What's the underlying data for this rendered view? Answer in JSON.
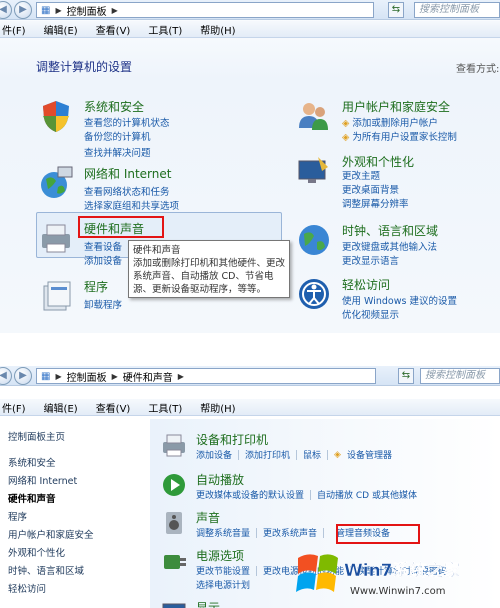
{
  "window1": {
    "breadcrumb": [
      "控制面板"
    ],
    "search_placeholder": "搜索控制面板",
    "menu": [
      "件(F)",
      "编辑(E)",
      "查看(V)",
      "工具(T)",
      "帮助(H)"
    ],
    "heading": "调整计算机的设置",
    "view_by": "查看方式:",
    "categories_left": [
      {
        "title": "系统和安全",
        "links": [
          "查看您的计算机状态",
          "备份您的计算机",
          "查找并解决问题"
        ]
      },
      {
        "title": "网络和 Internet",
        "links": [
          "查看网络状态和任务",
          "选择家庭组和共享选项"
        ]
      },
      {
        "title": "硬件和声音",
        "links": [
          "查看设备",
          "添加设备"
        ]
      },
      {
        "title": "程序",
        "links": [
          "卸载程序"
        ]
      }
    ],
    "categories_right": [
      {
        "title": "用户帐户和家庭安全",
        "links": [
          "添加或删除用户帐户",
          "为所有用户设置家长控制"
        ]
      },
      {
        "title": "外观和个性化",
        "links": [
          "更改主题",
          "更改桌面背景",
          "调整屏幕分辨率"
        ]
      },
      {
        "title": "时钟、语言和区域",
        "links": [
          "更改键盘或其他输入法",
          "更改显示语言"
        ]
      },
      {
        "title": "轻松访问",
        "links": [
          "使用 Windows 建议的设置",
          "优化视频显示"
        ]
      }
    ],
    "tooltip": {
      "title": "硬件和声音",
      "body": "添加或删除打印机和其他硬件、更改系统声音、自动播放 CD、节省电源、更新设备驱动程序，等等。"
    }
  },
  "window2": {
    "breadcrumb": [
      "控制面板",
      "硬件和声音"
    ],
    "search_placeholder": "搜索控制面板",
    "menu": [
      "件(F)",
      "编辑(E)",
      "查看(V)",
      "工具(T)",
      "帮助(H)"
    ],
    "sidebar": [
      "控制面板主页",
      "系统和安全",
      "网络和 Internet",
      "硬件和声音",
      "程序",
      "用户帐户和家庭安全",
      "外观和个性化",
      "时钟、语言和区域",
      "轻松访问"
    ],
    "sidebar_active_index": 3,
    "sections": [
      {
        "title": "设备和打印机",
        "links": [
          "添加设备",
          "添加打印机",
          "鼠标",
          "设备管理器"
        ]
      },
      {
        "title": "自动播放",
        "links": [
          "更改媒体或设备的默认设置",
          "自动播放 CD 或其他媒体"
        ]
      },
      {
        "title": "声音",
        "links": [
          "调整系统音量",
          "更改系统声音",
          "管理音频设备"
        ]
      },
      {
        "title": "电源选项",
        "links": [
          "更改节能设置",
          "更改电源按钮的功能",
          "唤醒计算机时需要密码"
        ],
        "extra": "选择电源计划"
      },
      {
        "title": "显示",
        "links": []
      }
    ]
  },
  "watermark": {
    "brand": "Win7系统之家",
    "url": "Www.Winwin7.com"
  },
  "colors": {
    "highlight_red": "#e31414",
    "link_blue": "#1a5aa8",
    "title_green": "#1e6e1e"
  }
}
